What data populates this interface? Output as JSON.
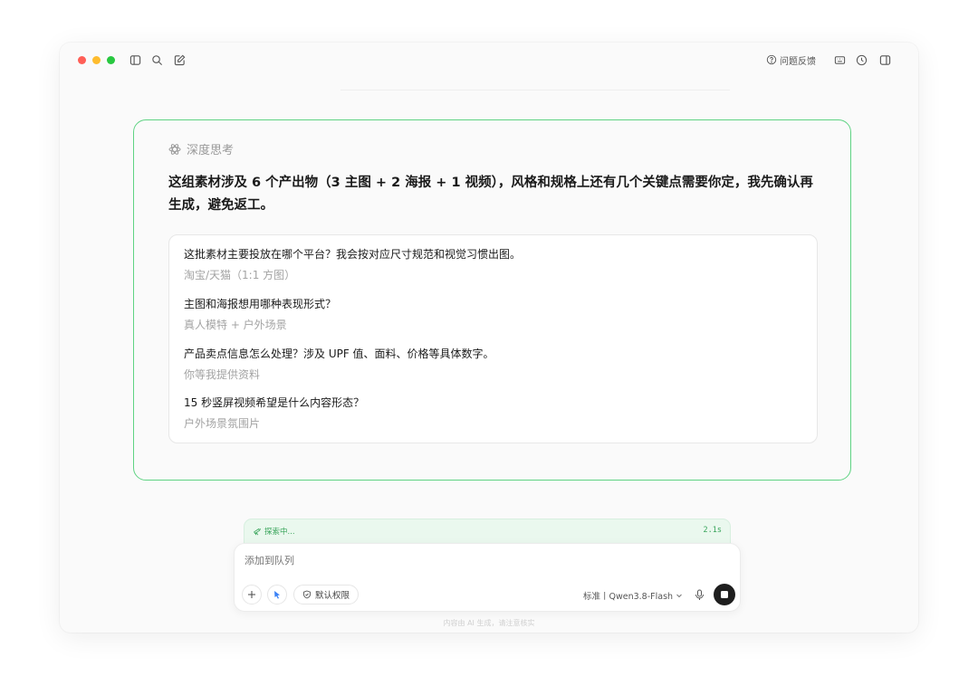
{
  "window": {
    "toolbar_icons": [
      "sidebar-toggle-icon",
      "search-icon",
      "new-chat-icon"
    ],
    "feedback_label": "问题反馈",
    "right_icons": [
      "keyboard-icon",
      "history-icon",
      "panel-toggle-icon"
    ]
  },
  "card": {
    "deep_think_label": "深度思考",
    "intro": "这组素材涉及 6 个产出物（3 主图 + 2 海报 + 1 视频），风格和规格上还有几个关键点需要你定，我先确认再生成，避免返工。",
    "questions": [
      {
        "question": "这批素材主要投放在哪个平台？我会按对应尺寸规范和视觉习惯出图。",
        "answer": "淘宝/天猫（1:1 方图）"
      },
      {
        "question": "主图和海报想用哪种表现形式？",
        "answer": "真人模特 + 户外场景"
      },
      {
        "question": "产品卖点信息怎么处理？涉及 UPF 值、面料、价格等具体数字。",
        "answer": "你等我提供资料"
      },
      {
        "question": "15 秒竖屏视频希望是什么内容形态？",
        "answer": "户外场景氛围片"
      }
    ]
  },
  "status": {
    "label": "探索中...",
    "time": "2.1s"
  },
  "composer": {
    "placeholder": "添加到队列",
    "permission_label": "默认权限",
    "model_label": "标准丨Qwen3.8-Flash"
  },
  "disclaimer": "内容由 AI 生成，请注意核实",
  "colors": {
    "accent_green": "#5fd383",
    "status_green": "#3aa55c",
    "cursor_blue": "#3b82f6"
  }
}
